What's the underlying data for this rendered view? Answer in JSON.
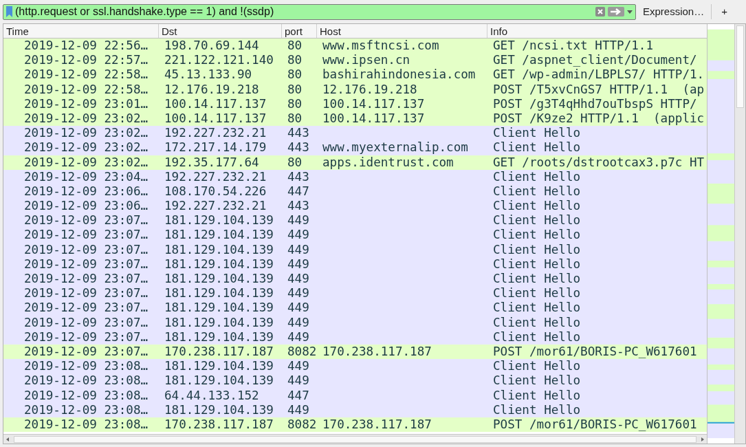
{
  "filter": {
    "value": "(http.request or ssl.handshake.type == 1) and !(ssdp)",
    "expression_button": "Expression…",
    "add_button": "+"
  },
  "table": {
    "columns": [
      "Time",
      "Dst",
      "port",
      "Host",
      "Info"
    ],
    "rows": [
      {
        "kind": "http",
        "time": "2019-12-09 22:56…",
        "dst": "198.70.69.144",
        "port": "80",
        "host": "www.msftncsi.com",
        "info": "GET /ncsi.txt HTTP/1.1"
      },
      {
        "kind": "http",
        "time": "2019-12-09 22:57…",
        "dst": "221.122.121.140",
        "port": "80",
        "host": "www.ipsen.cn",
        "info": "GET /aspnet_client/Document/"
      },
      {
        "kind": "http",
        "time": "2019-12-09 22:58…",
        "dst": "45.13.133.90",
        "port": "80",
        "host": "bashirahindonesia.com",
        "info": "GET /wp-admin/LBPLS7/ HTTP/1."
      },
      {
        "kind": "http",
        "time": "2019-12-09 22:58…",
        "dst": "12.176.19.218",
        "port": "80",
        "host": "12.176.19.218",
        "info": "POST /T5xvCnGS7 HTTP/1.1  (ap"
      },
      {
        "kind": "http",
        "time": "2019-12-09 23:01…",
        "dst": "100.14.117.137",
        "port": "80",
        "host": "100.14.117.137",
        "info": "POST /g3T4qHhd7ouTbspS HTTP/"
      },
      {
        "kind": "http",
        "time": "2019-12-09 23:02…",
        "dst": "100.14.117.137",
        "port": "80",
        "host": "100.14.117.137",
        "info": "POST /K9ze2 HTTP/1.1  (applic"
      },
      {
        "kind": "tls",
        "time": "2019-12-09 23:02…",
        "dst": "192.227.232.21",
        "port": "443",
        "info": "Client Hello"
      },
      {
        "kind": "tls",
        "time": "2019-12-09 23:02…",
        "dst": "172.217.14.179",
        "port": "443",
        "host": "www.myexternalip.com",
        "info": "Client Hello"
      },
      {
        "kind": "http",
        "time": "2019-12-09 23:02…",
        "dst": "192.35.177.64",
        "port": "80",
        "host": "apps.identrust.com",
        "info": "GET /roots/dstrootcax3.p7c HT"
      },
      {
        "kind": "tls",
        "time": "2019-12-09 23:04…",
        "dst": "192.227.232.21",
        "port": "443",
        "info": "Client Hello"
      },
      {
        "kind": "tls",
        "time": "2019-12-09 23:06…",
        "dst": "108.170.54.226",
        "port": "447",
        "info": "Client Hello"
      },
      {
        "kind": "tls",
        "time": "2019-12-09 23:06…",
        "dst": "192.227.232.21",
        "port": "443",
        "info": "Client Hello"
      },
      {
        "kind": "tls",
        "time": "2019-12-09 23:07…",
        "dst": "181.129.104.139",
        "port": "449",
        "info": "Client Hello"
      },
      {
        "kind": "tls",
        "time": "2019-12-09 23:07…",
        "dst": "181.129.104.139",
        "port": "449",
        "info": "Client Hello"
      },
      {
        "kind": "tls",
        "time": "2019-12-09 23:07…",
        "dst": "181.129.104.139",
        "port": "449",
        "info": "Client Hello"
      },
      {
        "kind": "tls",
        "time": "2019-12-09 23:07…",
        "dst": "181.129.104.139",
        "port": "449",
        "info": "Client Hello"
      },
      {
        "kind": "tls",
        "time": "2019-12-09 23:07…",
        "dst": "181.129.104.139",
        "port": "449",
        "info": "Client Hello"
      },
      {
        "kind": "tls",
        "time": "2019-12-09 23:07…",
        "dst": "181.129.104.139",
        "port": "449",
        "info": "Client Hello"
      },
      {
        "kind": "tls",
        "time": "2019-12-09 23:07…",
        "dst": "181.129.104.139",
        "port": "449",
        "info": "Client Hello"
      },
      {
        "kind": "tls",
        "time": "2019-12-09 23:07…",
        "dst": "181.129.104.139",
        "port": "449",
        "info": "Client Hello"
      },
      {
        "kind": "tls",
        "time": "2019-12-09 23:07…",
        "dst": "181.129.104.139",
        "port": "449",
        "info": "Client Hello"
      },
      {
        "kind": "http",
        "time": "2019-12-09 23:07…",
        "dst": "170.238.117.187",
        "port": "8082",
        "host": "170.238.117.187",
        "info": "POST /mor61/BORIS-PC_W617601"
      },
      {
        "kind": "tls",
        "time": "2019-12-09 23:08…",
        "dst": "181.129.104.139",
        "port": "449",
        "info": "Client Hello"
      },
      {
        "kind": "tls",
        "time": "2019-12-09 23:08…",
        "dst": "181.129.104.139",
        "port": "449",
        "info": "Client Hello"
      },
      {
        "kind": "tls",
        "time": "2019-12-09 23:08…",
        "dst": "64.44.133.152",
        "port": "447",
        "info": "Client Hello"
      },
      {
        "kind": "tls",
        "time": "2019-12-09 23:08…",
        "dst": "181.129.104.139",
        "port": "449",
        "info": "Client Hello"
      },
      {
        "kind": "http",
        "time": "2019-12-09 23:08…",
        "dst": "170.238.117.187",
        "port": "8082",
        "host": "170.238.117.187",
        "info": "POST /mor61/BORIS-PC_W617601"
      }
    ]
  }
}
